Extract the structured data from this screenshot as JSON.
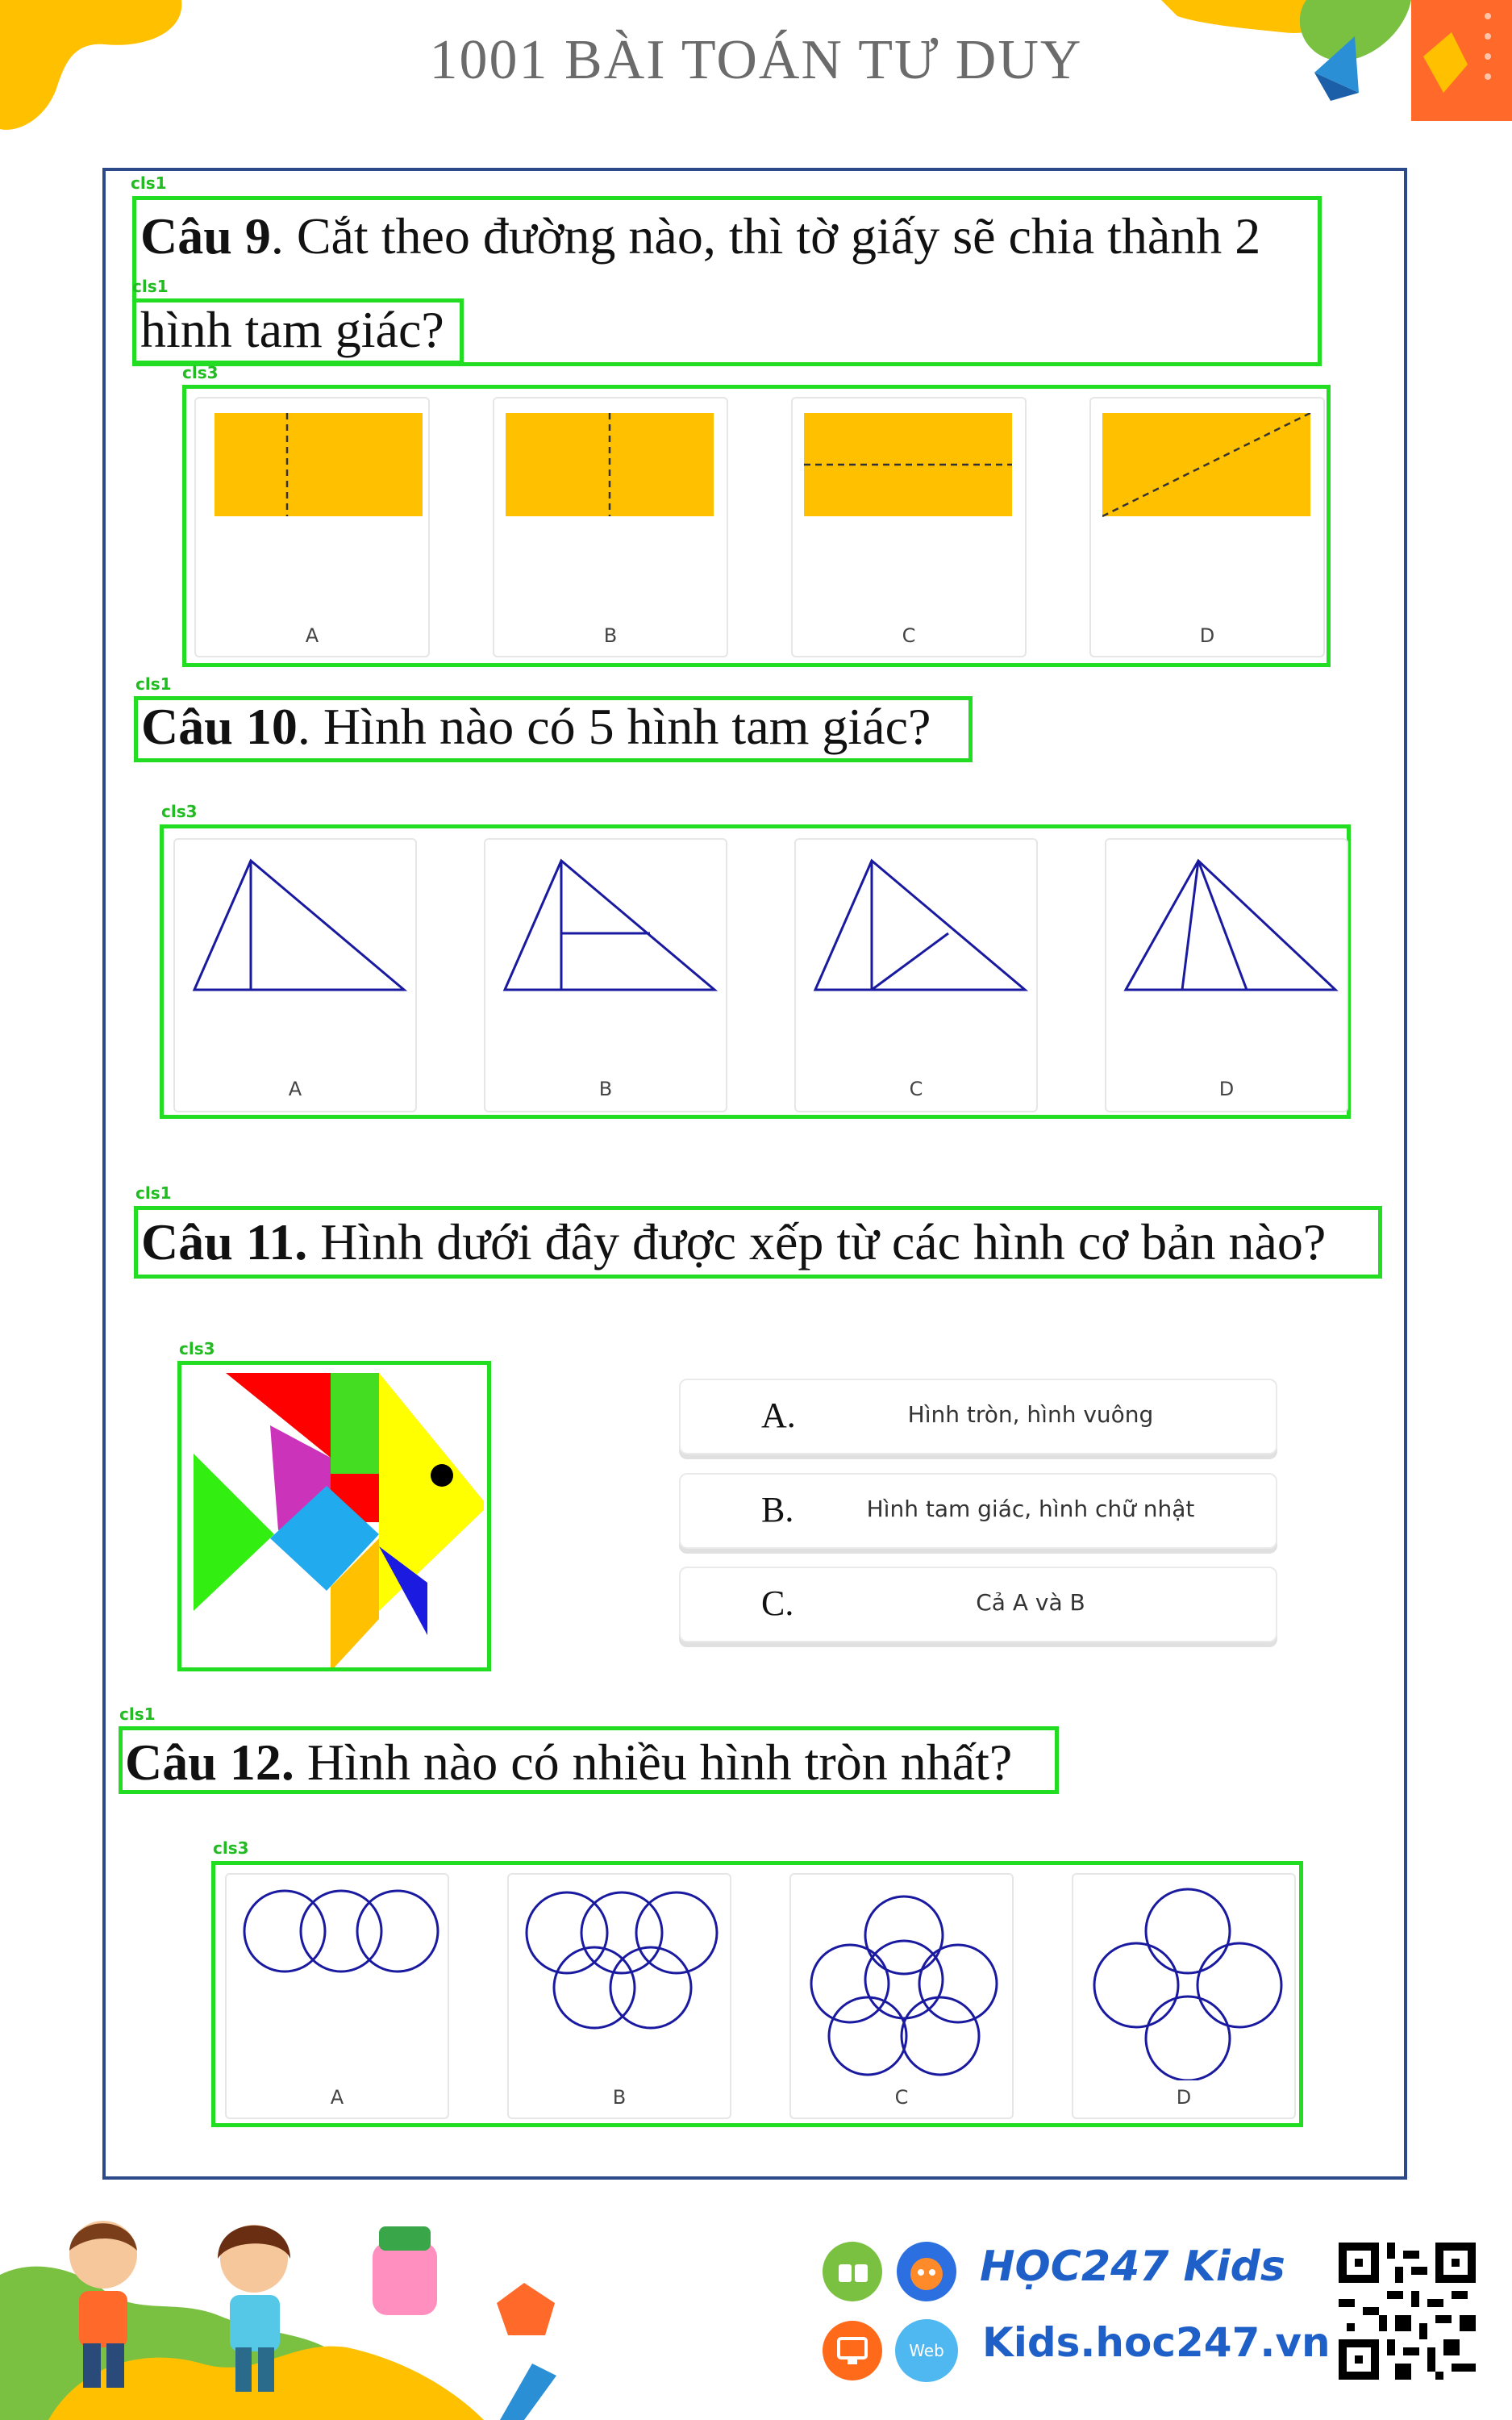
{
  "header": {
    "title": "1001 BÀI TOÁN TƯ DUY"
  },
  "tags": {
    "cls1": "cls1",
    "cls3": "cls3"
  },
  "q9": {
    "num": "Câu 9",
    "line1": ". Cắt theo đường nào, thì tờ giấy sẽ chia thành 2",
    "line2": "hình tam giác?",
    "options": [
      "A",
      "B",
      "C",
      "D"
    ]
  },
  "q10": {
    "num": "Câu 10",
    "text": ". Hình nào có 5 hình tam giác?",
    "options": [
      "A",
      "B",
      "C",
      "D"
    ]
  },
  "q11": {
    "num": "Câu 11.",
    "text": " Hình dưới đây được xếp từ các hình cơ bản nào?",
    "answers": [
      {
        "letter": "A.",
        "text": "Hình tròn, hình vuông"
      },
      {
        "letter": "B.",
        "text": "Hình tam giác, hình chữ nhật"
      },
      {
        "letter": "C.",
        "text": "Cả A và B"
      }
    ]
  },
  "q12": {
    "num": "Câu 12.",
    "text": " Hình nào có nhiều hình tròn nhất?",
    "options": [
      "A",
      "B",
      "C",
      "D"
    ]
  },
  "footer": {
    "brand_logo": "HỌC247 Kids",
    "website": "Kids.hoc247.vn",
    "web_badge": "Web"
  },
  "colors": {
    "paper": "#ffc000",
    "stroke": "#1a1aa0",
    "green_box": "#22dd22",
    "frame": "#2c4a8a"
  }
}
